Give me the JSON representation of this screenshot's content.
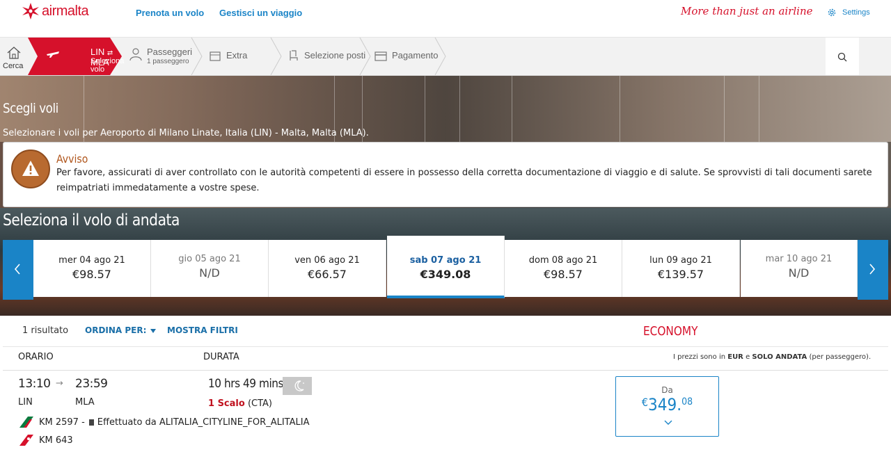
{
  "header": {
    "brand": "airmalta",
    "nav": [
      "Prenota un volo",
      "Gestisci un viaggio"
    ],
    "tagline": "More than just an airline",
    "settings": "Settings"
  },
  "steps": {
    "home": "Cerca",
    "active_route_from": "LIN",
    "active_route_sep": "⇄",
    "active_route_to": "MLA",
    "active_sub": "Seleziona volo",
    "passengers": "Passeggeri",
    "passengers_sub": "1 passeggero",
    "extra": "Extra",
    "seats": "Selezione posti",
    "payment": "Pagamento"
  },
  "hero": {
    "title": "Scegli voli",
    "subtitle": "Selezionare i voli per Aeroporto di Milano Linate, Italia (LIN) - Malta, Malta (MLA)."
  },
  "warning": {
    "title": "Avviso",
    "text": "Per favore, assicurati di aver controllato con le autorità competenti di essere in possesso della corretta documentazione di viaggio e di salute. Se sprovvisti di tali documenti sarete reimpatriati immedatamente a vostre spese."
  },
  "outbound_title": "Seleziona il volo di andata",
  "dates": [
    {
      "label": "mer 04 ago 21",
      "price": "€98.57"
    },
    {
      "label": "gio 05 ago 21",
      "price": "N/D"
    },
    {
      "label": "ven 06 ago 21",
      "price": "€66.57"
    },
    {
      "label": "sab 07 ago 21",
      "price": "€349.08"
    },
    {
      "label": "dom 08 ago 21",
      "price": "€98.57"
    },
    {
      "label": "lun 09 ago 21",
      "price": "€139.57"
    },
    {
      "label": "mar 10 ago 21",
      "price": "N/D"
    }
  ],
  "results": {
    "count": "1 risultato",
    "sort": "ORDINA PER:",
    "filters": "MOSTRA FILTRI",
    "cabin": "ECONOMY",
    "col_time": "ORARIO",
    "col_duration": "DURATA",
    "note_pre": "I prezzi sono in ",
    "note_cur": "EUR",
    "note_mid": " e ",
    "note_type": "SOLO ANDATA",
    "note_post": " (per passeggero)."
  },
  "flight": {
    "dep_time": "13:10",
    "arr_time": "23:59",
    "dep_code": "LIN",
    "arr_code": "MLA",
    "duration": "10 hrs 49 mins",
    "stops": "1 Scalo",
    "stop_code": "(CTA)",
    "leg1_number": "KM 2597 -",
    "leg1_operator": "Effettuato da ALITALIA_CITYLINE_FOR_ALITALIA",
    "leg2_number": "KM 643",
    "price_label": "Da",
    "price_currency": "€",
    "price_int": "349.",
    "price_dec": "08"
  },
  "colors": {
    "brand_red": "#d6112b",
    "link_blue": "#1a84c7",
    "warning_brown": "#b86a30"
  }
}
